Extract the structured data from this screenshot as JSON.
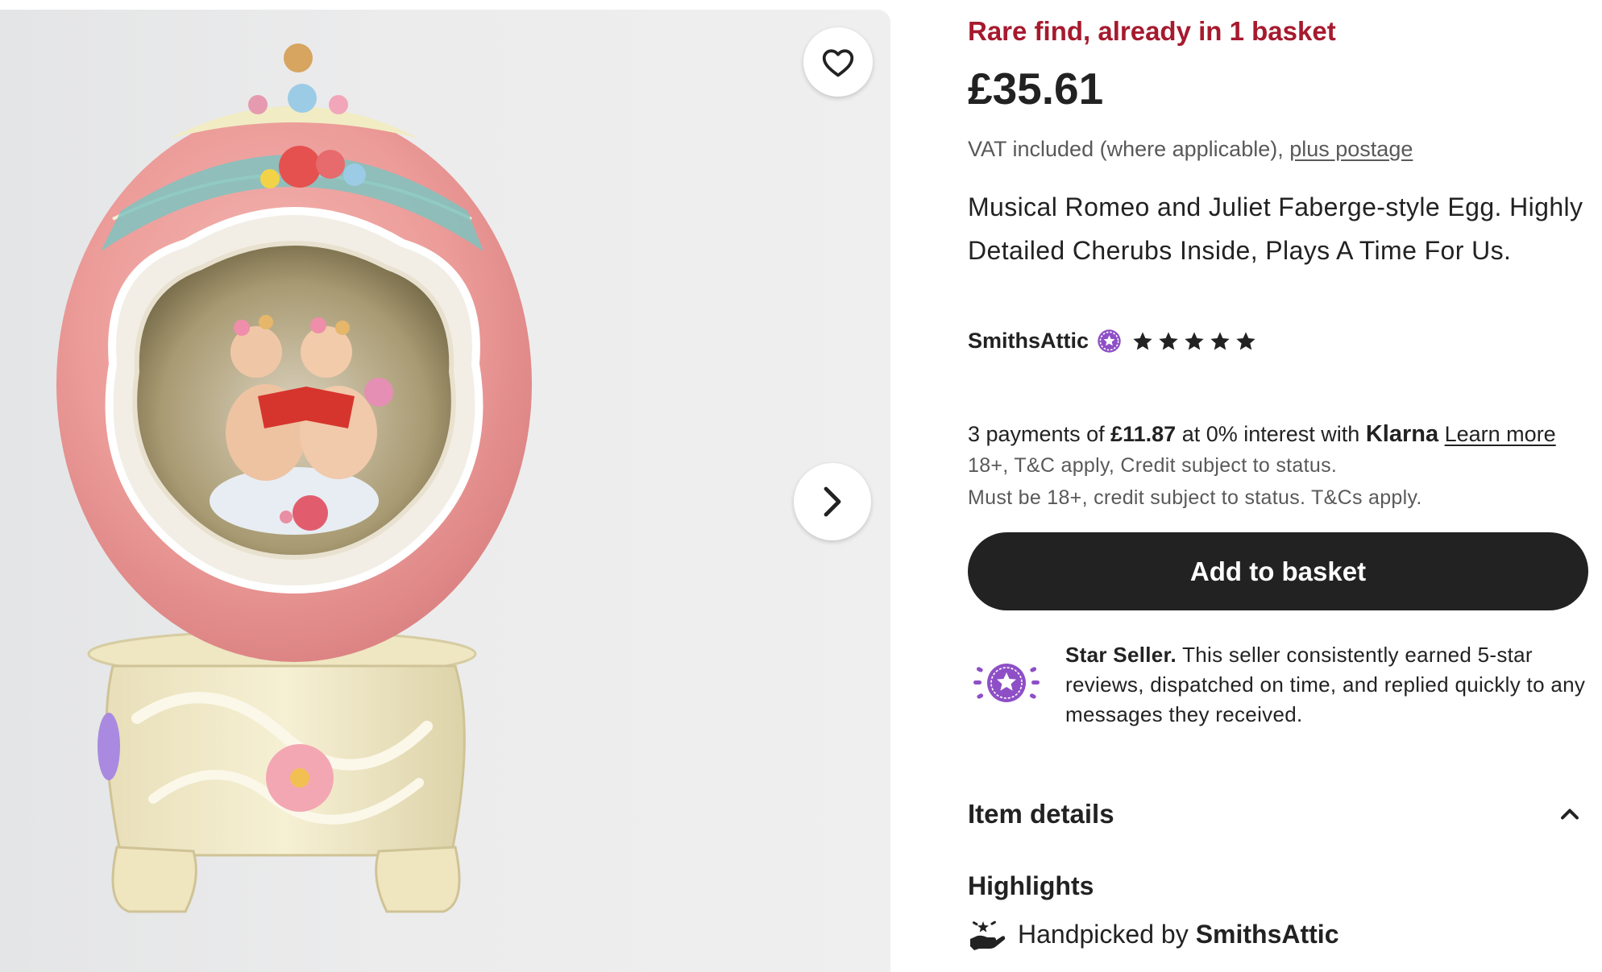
{
  "listing": {
    "scarcity_label": "Rare find, already in 1 basket",
    "price": "£35.61",
    "vat_note": "VAT included (where applicable),",
    "postage_link": "plus postage",
    "title": "Musical Romeo and Juliet Faberge-style Egg. Highly Detailed Cherubs Inside, Plays A Time For Us."
  },
  "shop": {
    "name": "SmithsAttic",
    "rating_stars": 5,
    "badge_icon": "star-seller-badge-icon"
  },
  "klarna": {
    "prefix": "3 payments of",
    "amount": "£11.87",
    "middle": "at 0% interest with",
    "brand": "Klarna",
    "learn_more": "Learn more",
    "terms_line1": "18+, T&C apply, Credit subject to status.",
    "terms_line2": "Must be 18+, credit subject to status. T&Cs apply."
  },
  "actions": {
    "add_to_basket": "Add to basket",
    "favorite_icon": "heart-icon",
    "next_icon": "chevron-right-icon"
  },
  "star_seller": {
    "label": "Star Seller.",
    "description": "This seller consistently earned 5-star reviews, dispatched on time, and replied quickly to any messages they received."
  },
  "details": {
    "section_title": "Item details",
    "highlights_title": "Highlights",
    "handpicked_label": "Handpicked by",
    "handpicked_shop": "SmithsAttic"
  },
  "colors": {
    "scarcity_red": "#a61a2e",
    "button_dark": "#222222",
    "star_seller_purple": "#8e4fc6",
    "muted_text": "#595959"
  }
}
